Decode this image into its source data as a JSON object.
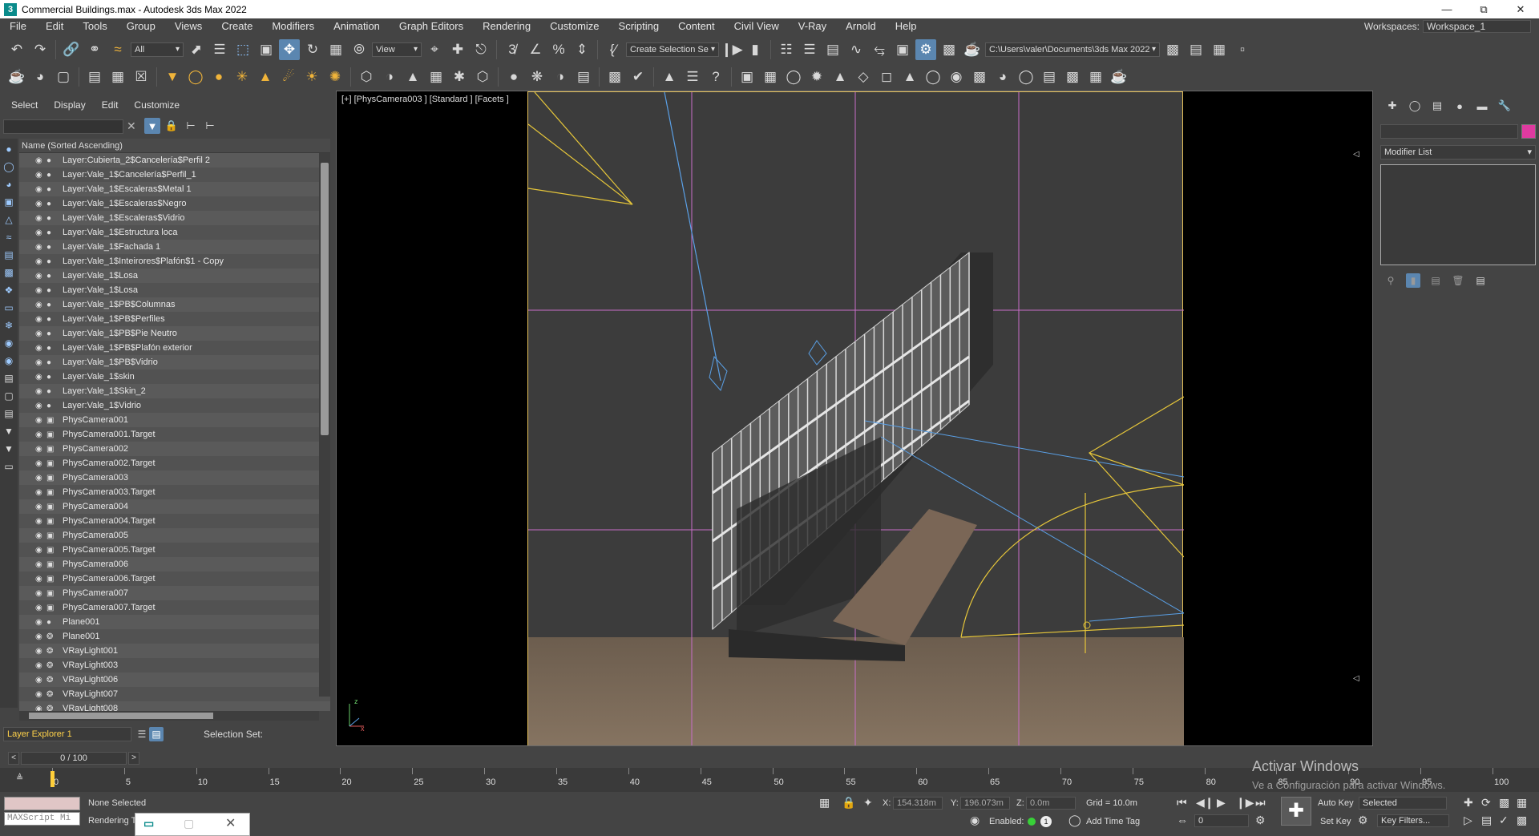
{
  "window": {
    "title": "Commercial Buildings.max - Autodesk 3ds Max 2022",
    "app_icon": "3"
  },
  "menubar": {
    "items": [
      "File",
      "Edit",
      "Tools",
      "Group",
      "Views",
      "Create",
      "Modifiers",
      "Animation",
      "Graph Editors",
      "Rendering",
      "Customize",
      "Scripting",
      "Content",
      "Civil View",
      "V-Ray",
      "Arnold",
      "Help"
    ],
    "workspaces_label": "Workspaces:",
    "workspace_value": "Workspace_1"
  },
  "toolbar": {
    "selection_filter": "All",
    "ref_coord": "View",
    "selection_set": "Create Selection Se",
    "project_path": "C:\\Users\\valer\\Documents\\3ds Max 2022"
  },
  "explorer": {
    "menu": [
      "Select",
      "Display",
      "Edit",
      "Customize"
    ],
    "column_header": "Name (Sorted Ascending)",
    "rows": [
      {
        "name": "Layer:Cubierta_2$Cancelería$Perfil 2",
        "icon": "layer"
      },
      {
        "name": "Layer:Vale_1$Cancelería$Perfil_1",
        "icon": "layer"
      },
      {
        "name": "Layer:Vale_1$Escaleras$Metal 1",
        "icon": "layer"
      },
      {
        "name": "Layer:Vale_1$Escaleras$Negro",
        "icon": "layer"
      },
      {
        "name": "Layer:Vale_1$Escaleras$Vidrio",
        "icon": "layer"
      },
      {
        "name": "Layer:Vale_1$Estructura loca",
        "icon": "layer"
      },
      {
        "name": "Layer:Vale_1$Fachada 1",
        "icon": "layer"
      },
      {
        "name": "Layer:Vale_1$Inteirores$Plafón$1 - Copy",
        "icon": "layer"
      },
      {
        "name": "Layer:Vale_1$Losa",
        "icon": "layer"
      },
      {
        "name": "Layer:Vale_1$Losa",
        "icon": "layer"
      },
      {
        "name": "Layer:Vale_1$PB$Columnas",
        "icon": "layer"
      },
      {
        "name": "Layer:Vale_1$PB$Perfiles",
        "icon": "layer"
      },
      {
        "name": "Layer:Vale_1$PB$Pie Neutro",
        "icon": "layer"
      },
      {
        "name": "Layer:Vale_1$PB$Plafón exterior",
        "icon": "layer"
      },
      {
        "name": "Layer:Vale_1$PB$Vidrio",
        "icon": "layer"
      },
      {
        "name": "Layer:Vale_1$skin",
        "icon": "layer"
      },
      {
        "name": "Layer:Vale_1$Skin_2",
        "icon": "layer"
      },
      {
        "name": "Layer:Vale_1$Vidrio",
        "icon": "layer"
      },
      {
        "name": "PhysCamera001",
        "icon": "camera"
      },
      {
        "name": "PhysCamera001.Target",
        "icon": "camera"
      },
      {
        "name": "PhysCamera002",
        "icon": "camera"
      },
      {
        "name": "PhysCamera002.Target",
        "icon": "camera"
      },
      {
        "name": "PhysCamera003",
        "icon": "camera"
      },
      {
        "name": "PhysCamera003.Target",
        "icon": "camera"
      },
      {
        "name": "PhysCamera004",
        "icon": "camera"
      },
      {
        "name": "PhysCamera004.Target",
        "icon": "camera"
      },
      {
        "name": "PhysCamera005",
        "icon": "camera"
      },
      {
        "name": "PhysCamera005.Target",
        "icon": "camera"
      },
      {
        "name": "PhysCamera006",
        "icon": "camera"
      },
      {
        "name": "PhysCamera006.Target",
        "icon": "camera"
      },
      {
        "name": "PhysCamera007",
        "icon": "camera"
      },
      {
        "name": "PhysCamera007.Target",
        "icon": "camera"
      },
      {
        "name": "Plane001",
        "icon": "layer"
      },
      {
        "name": "Plane001",
        "icon": "light"
      },
      {
        "name": "VRayLight001",
        "icon": "light"
      },
      {
        "name": "VRayLight003",
        "icon": "light"
      },
      {
        "name": "VRayLight006",
        "icon": "light"
      },
      {
        "name": "VRayLight007",
        "icon": "light"
      },
      {
        "name": "VRayLight008",
        "icon": "light"
      }
    ],
    "footer_dropdown": "Layer Explorer 1",
    "selection_set_label": "Selection Set:"
  },
  "viewport": {
    "label": "[+] [PhysCamera003 ] [Standard ] [Facets ]",
    "axis_x": "x",
    "axis_z": "z"
  },
  "command_panel": {
    "modifier_list": "Modifier List",
    "object_color": "#e03aa0"
  },
  "timeline": {
    "frame_display": "0 / 100",
    "ticks": [
      "0",
      "5",
      "10",
      "15",
      "20",
      "25",
      "30",
      "35",
      "40",
      "45",
      "50",
      "55",
      "60",
      "65",
      "70",
      "75",
      "80",
      "85",
      "90",
      "95",
      "100"
    ],
    "activate_title": "Activar Windows",
    "activate_sub": "Ve a Configuración para activar Windows."
  },
  "statusbar": {
    "selection_status": "None Selected",
    "rendering_label": "Rendering T",
    "maxscript_label": "MAXScript Mi",
    "x_label": "X:",
    "x_value": "154.318m",
    "y_label": "Y:",
    "y_value": "196.073m",
    "z_label": "Z:",
    "z_value": "0.0m",
    "grid": "Grid = 10.0m",
    "enabled_label": "Enabled:",
    "add_time_tag": "Add Time Tag",
    "auto_key": "Auto Key",
    "set_key": "Set Key",
    "key_mode": "Selected",
    "key_filters": "Key Filters...",
    "frame_value": "0"
  }
}
